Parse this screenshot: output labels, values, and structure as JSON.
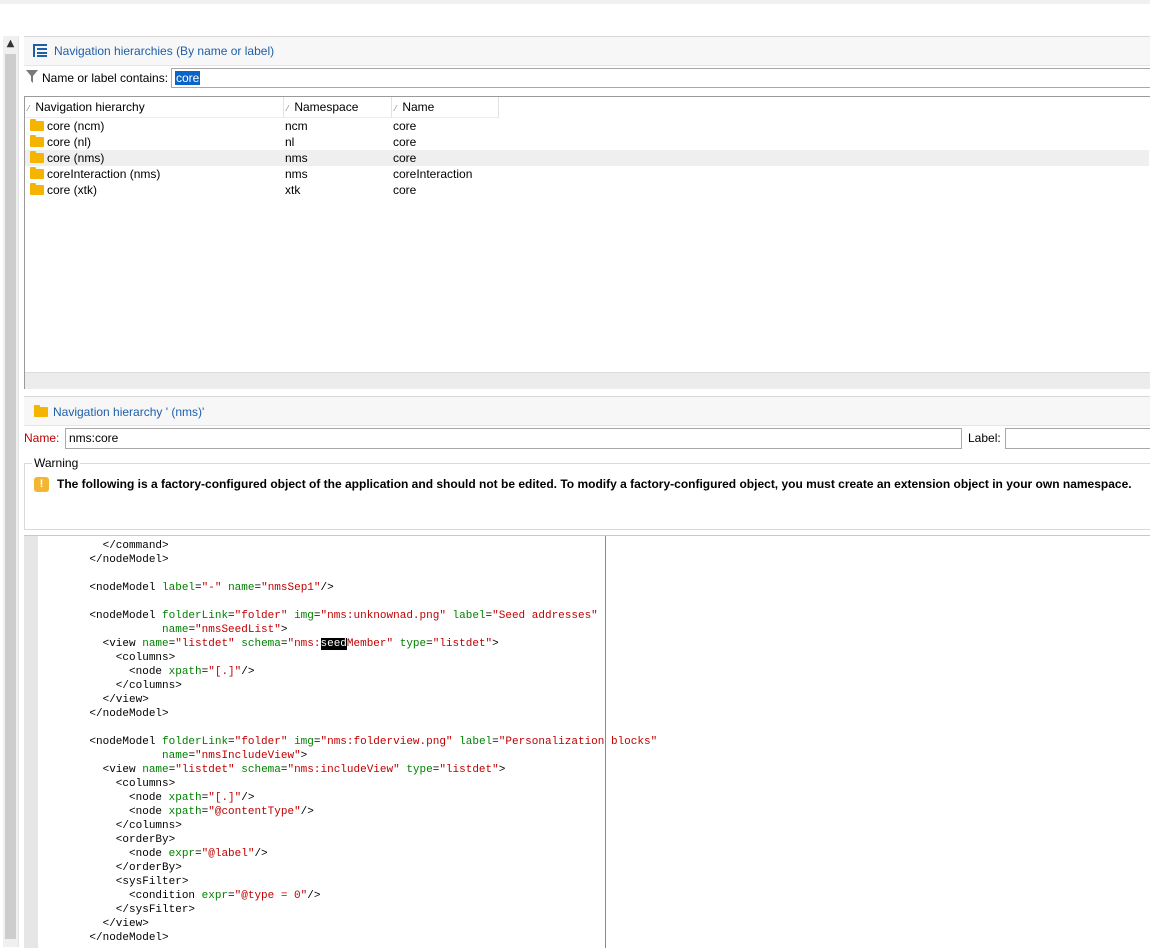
{
  "list_panel": {
    "title": "Navigation hierarchies (By name or label)",
    "filter_label": "Name or label contains:",
    "filter_value": "core"
  },
  "grid": {
    "columns": [
      "Navigation hierarchy",
      "Namespace",
      "Name"
    ],
    "rows": [
      {
        "hierarchy": "core (ncm)",
        "namespace": "ncm",
        "name": "core"
      },
      {
        "hierarchy": "core (nl)",
        "namespace": "nl",
        "name": "core"
      },
      {
        "hierarchy": "core (nms)",
        "namespace": "nms",
        "name": "core"
      },
      {
        "hierarchy": "coreInteraction (nms)",
        "namespace": "nms",
        "name": "coreInteraction"
      },
      {
        "hierarchy": "core (xtk)",
        "namespace": "xtk",
        "name": "core"
      }
    ],
    "selected_row": 2
  },
  "detail": {
    "title": "Navigation hierarchy ' (nms)'",
    "name_label": "Name:",
    "name_value": "nms:core",
    "label_label": "Label:",
    "label_value": "",
    "warning_legend": "Warning",
    "warning_text": "The following is a factory-configured object of the application and should not be edited. To modify a factory-configured object, you must create an extension object in your own namespace."
  },
  "editor": {
    "search_highlight": "seed",
    "lines": [
      "      </command>",
      "    </nodeModel>",
      "",
      "    <nodeModel label=\"-\" name=\"nmsSep1\"/>",
      "",
      "    <nodeModel folderLink=\"folder\" img=\"nms:unknownad.png\" label=\"Seed addresses\"",
      "               name=\"nmsSeedList\">",
      "      <view name=\"listdet\" schema=\"nms:seedMember\" type=\"listdet\">",
      "        <columns>",
      "          <node xpath=\"[.]\"/>",
      "        </columns>",
      "      </view>",
      "    </nodeModel>",
      "",
      "    <nodeModel folderLink=\"folder\" img=\"nms:folderview.png\" label=\"Personalization blocks\"",
      "               name=\"nmsIncludeView\">",
      "      <view name=\"listdet\" schema=\"nms:includeView\" type=\"listdet\">",
      "        <columns>",
      "          <node xpath=\"[.]\"/>",
      "          <node xpath=\"@contentType\"/>",
      "        </columns>",
      "        <orderBy>",
      "          <node expr=\"@label\"/>",
      "        </orderBy>",
      "        <sysFilter>",
      "          <condition expr=\"@type = 0\"/>",
      "        </sysFilter>",
      "      </view>",
      "    </nodeModel>"
    ]
  },
  "colors": {
    "title_blue": "#1f5fa8",
    "folder_yellow": "#f4b400",
    "required_red": "#c00000",
    "attr_green": "#008000",
    "string_red": "#c00000"
  },
  "icons": {
    "tree": "hierarchy-icon",
    "filter": "funnel-icon",
    "folder": "folder-icon",
    "warning": "warning-icon",
    "sort": "sort-icon"
  }
}
